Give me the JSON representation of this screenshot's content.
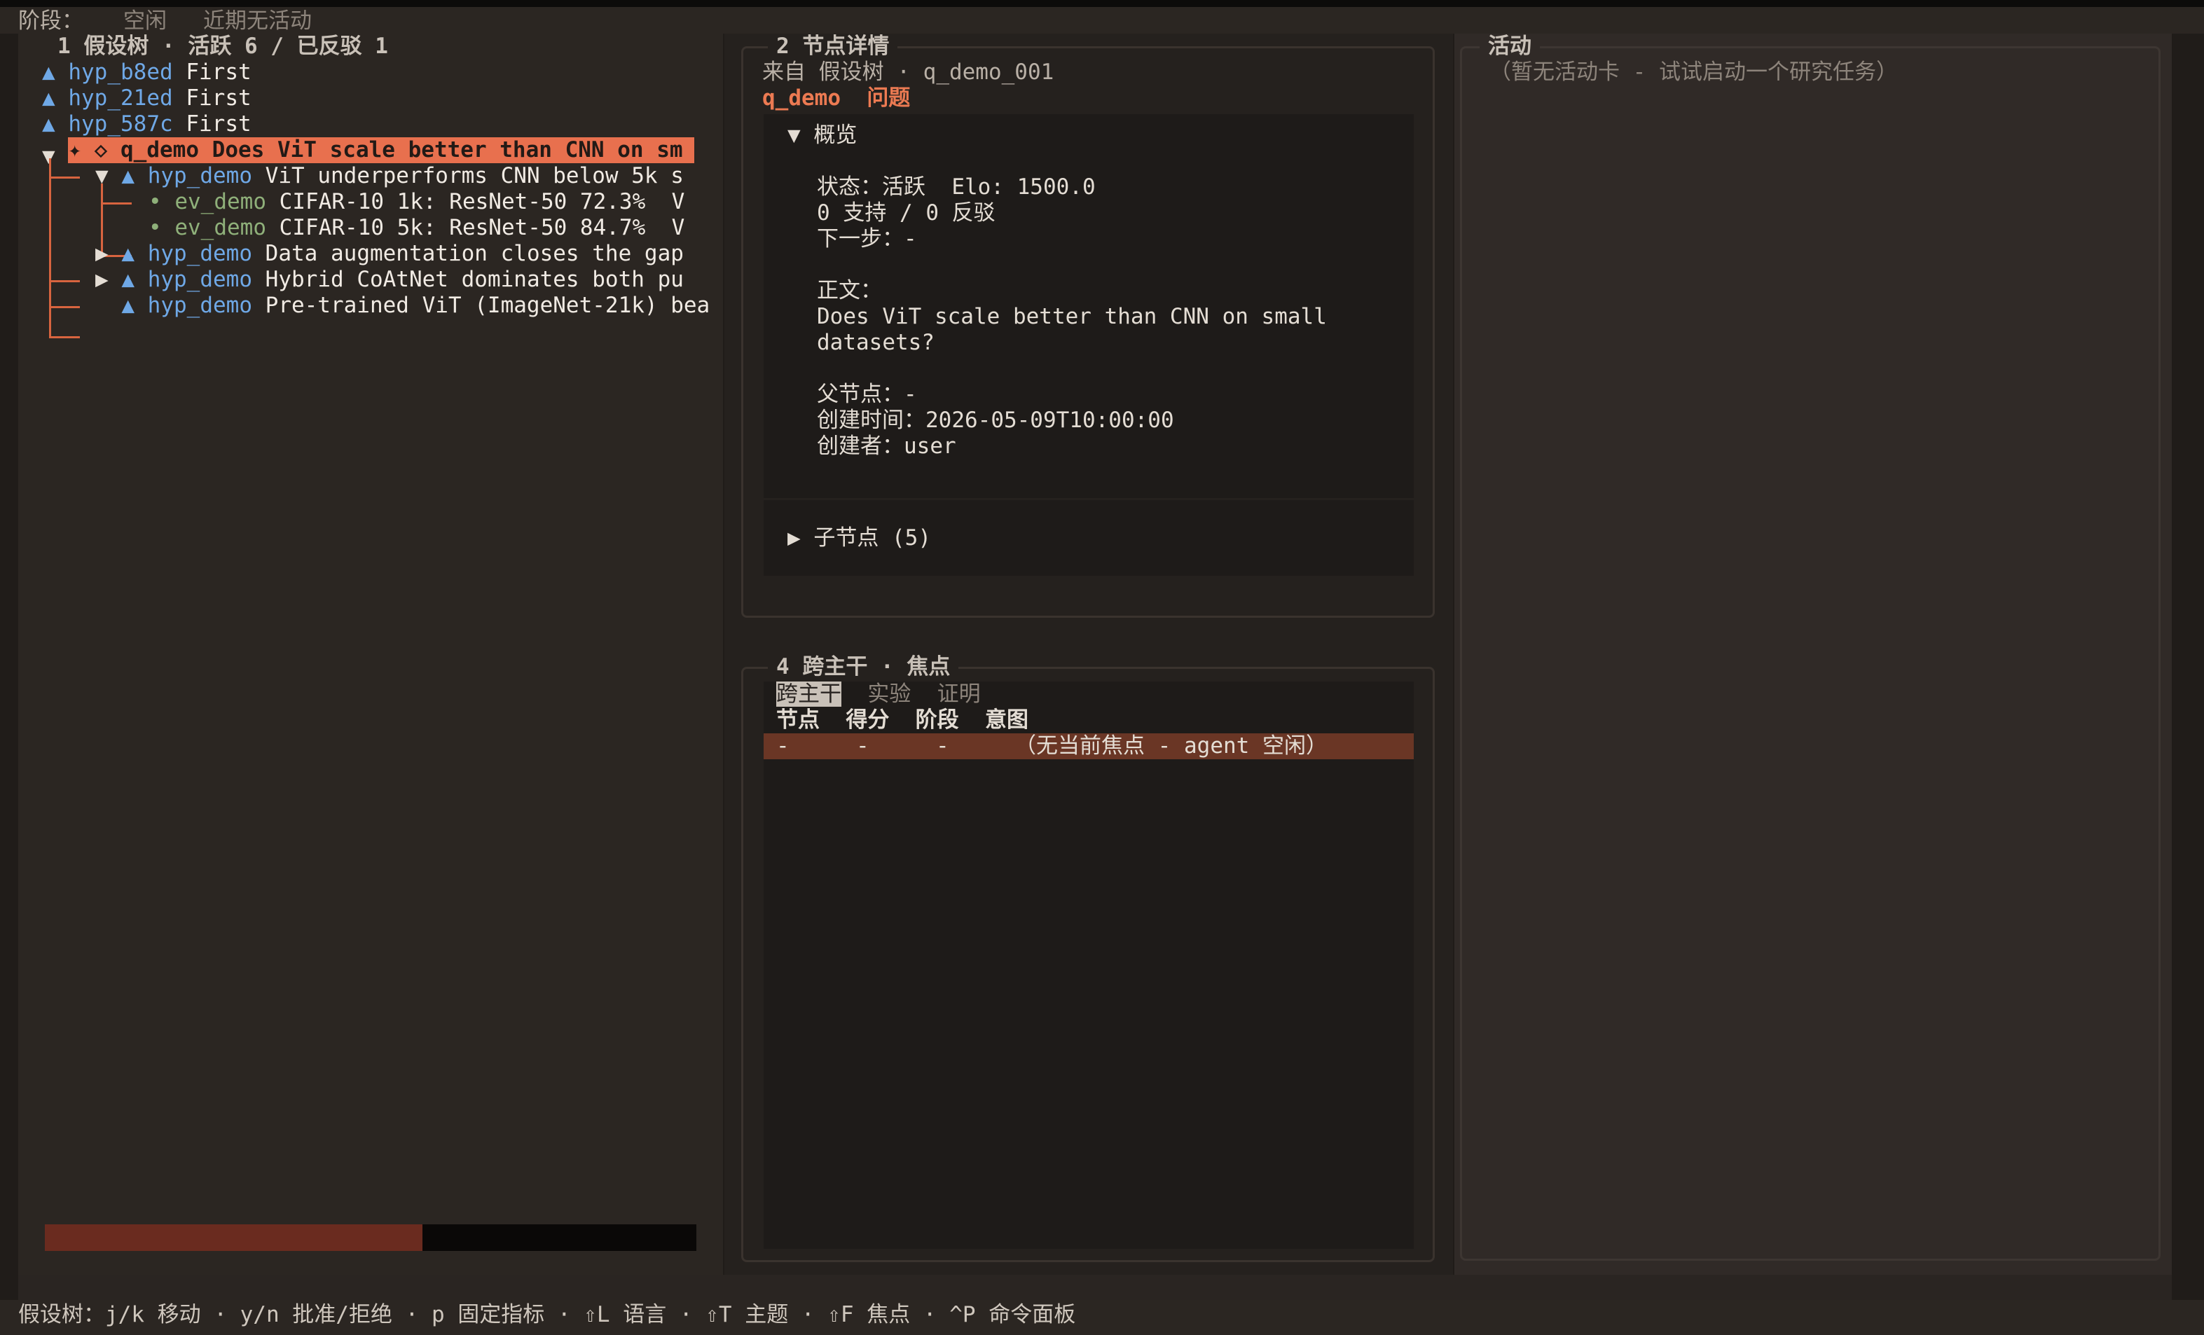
{
  "topbar": {
    "stage_label": "阶段：",
    "stage_value": "空闲",
    "activity": "近期无活动"
  },
  "left": {
    "title": "1 假设树 · 活跃 6 / 已反驳 1",
    "roots": [
      {
        "id": "hyp_b8ed",
        "text": "First"
      },
      {
        "id": "hyp_21ed",
        "text": "First"
      },
      {
        "id": "hyp_587c",
        "text": "First"
      }
    ],
    "selected": {
      "prefix": "✦ ◇",
      "id": "q_demo",
      "text": "Does ViT scale better than CNN on sm"
    },
    "children": [
      {
        "id": "hyp_demo",
        "text": "ViT underperforms CNN below 5k s"
      },
      {
        "id": "ev_demo",
        "text": "CIFAR-10 1k: ResNet-50 72.3%  V"
      },
      {
        "id": "ev_demo",
        "text": "CIFAR-10 5k: ResNet-50 84.7%  V"
      },
      {
        "id": "hyp_demo",
        "text": "Data augmentation closes the gap"
      },
      {
        "id": "hyp_demo",
        "text": "Hybrid CoAtNet dominates both pu"
      },
      {
        "id": "hyp_demo",
        "text": "Pre-trained ViT (ImageNet-21k) bea"
      }
    ],
    "progress": 0.58
  },
  "detail": {
    "title": "2 节点详情",
    "from": "来自 假设树 · q_demo_001",
    "node_id": "q_demo",
    "node_type": "问题",
    "overview_label": "概览",
    "status_line": "状态：活跃  Elo: 1500.0",
    "support_line": "0 支持 / 0 反驳",
    "next_line": "下一步：-",
    "body_label": "正文：",
    "body_1": "Does ViT scale better than CNN on small",
    "body_2": "datasets?",
    "parent_line": "父节点：-",
    "created_line": "创建时间：2026-05-09T10:00:00",
    "creator_line": "创建者：user",
    "children_label": "子节点 (5)"
  },
  "focus": {
    "title": "4 跨主干 · 焦点",
    "tabs": [
      "跨主干",
      "实验",
      "证明"
    ],
    "headers": [
      "节点",
      "得分",
      "阶段",
      "意图"
    ],
    "row": [
      "-",
      "-",
      "-",
      "（无当前焦点 - agent 空闲）"
    ]
  },
  "activity": {
    "title": "活动",
    "empty": "（暂无活动卡 - 试试启动一个研究任务）"
  },
  "bottombar": {
    "hint": "假设树：j/k 移动 · y/n 批准/拒绝 · p 固定指标 · ⇧L 语言 · ⇧T 主题 · ⇧F 焦点 · ^P 命令面板"
  },
  "colors": {
    "accent": "#e8704e",
    "hyp": "#6fa8e6",
    "evidence": "#8fb07a"
  }
}
